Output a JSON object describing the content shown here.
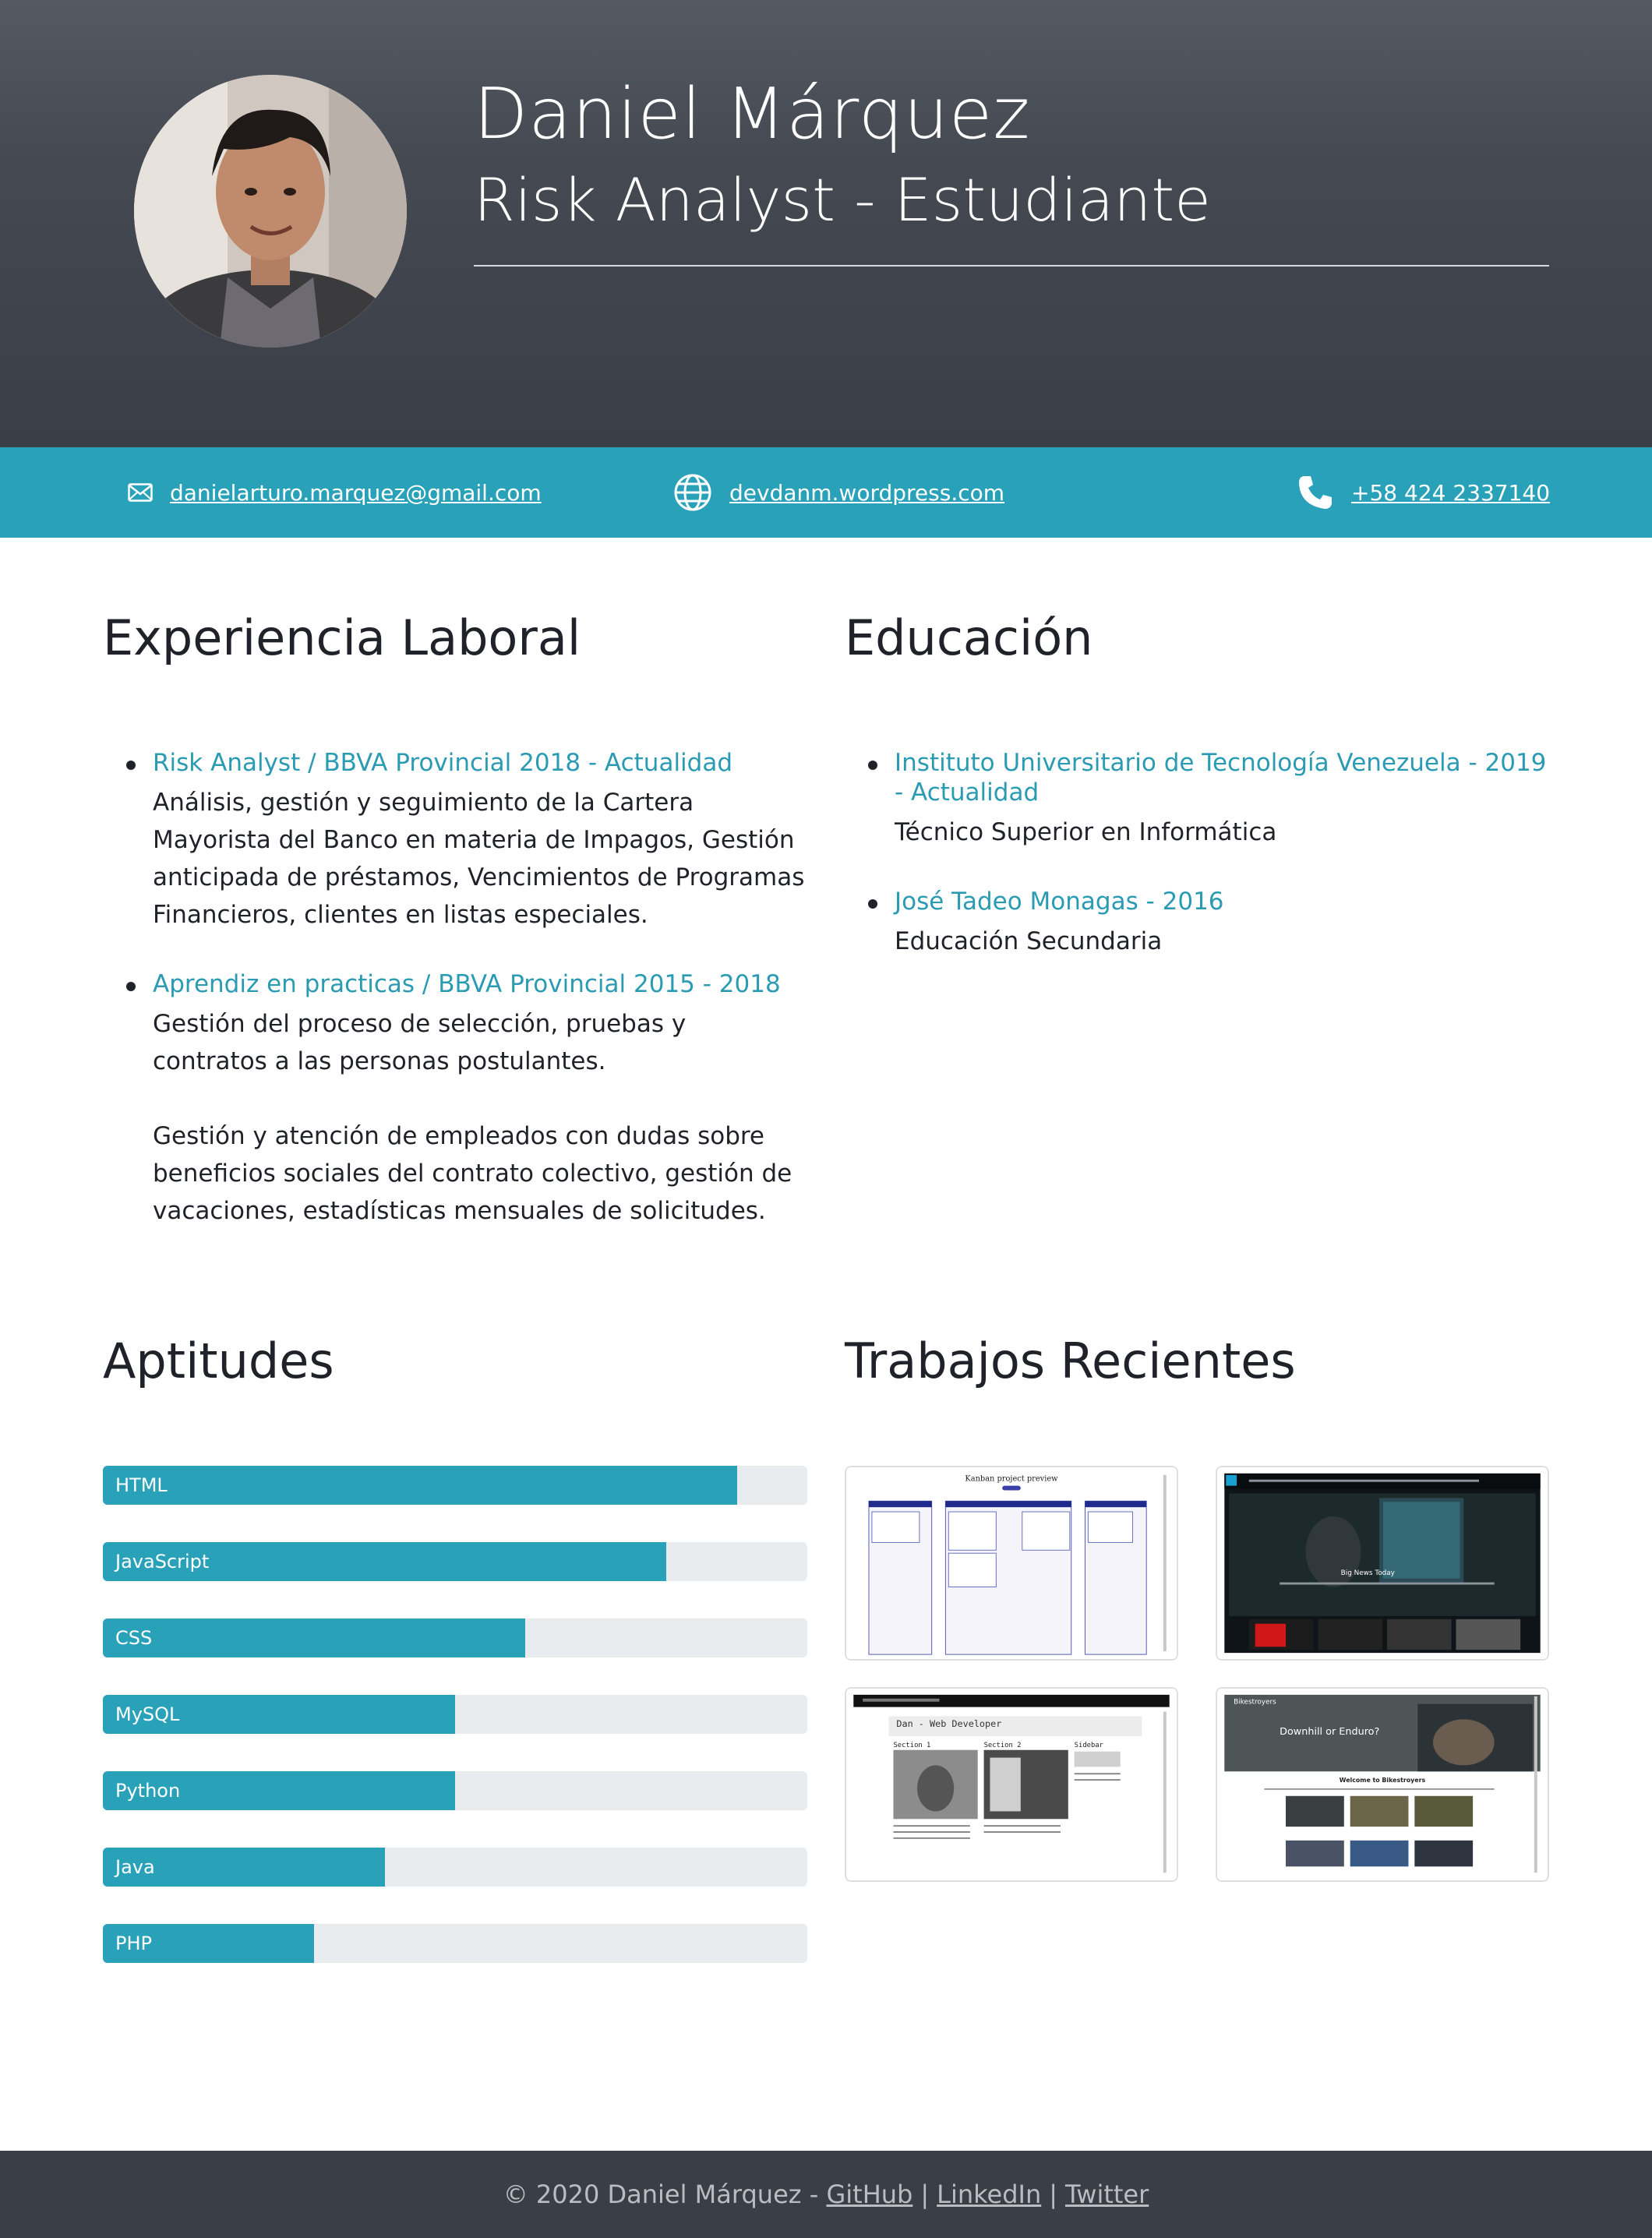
{
  "header": {
    "name": "Daniel Márquez",
    "role": "Risk Analyst - Estudiante"
  },
  "contact": {
    "email": "danielarturo.marquez@gmail.com",
    "website": "devdanm.wordpress.com",
    "phone": "+58 424 2337140"
  },
  "experience": {
    "title": "Experiencia Laboral",
    "items": [
      {
        "title": "Risk Analyst / BBVA Provincial 2018 - Actualidad",
        "desc": "Análisis, gestión y seguimiento de la Cartera Mayorista del Banco en materia de Impagos, Gestión anticipada de préstamos, Vencimientos de Programas Financieros, clientes en listas especiales."
      },
      {
        "title": "Aprendiz en practicas / BBVA Provincial 2015 - 2018",
        "desc": "Gestión del proceso de selección, pruebas y contratos a las personas postulantes.",
        "desc2": "Gestión y atención de empleados con dudas sobre beneficios sociales del contrato colectivo, gestión de vacaciones, estadísticas mensuales de solicitudes."
      }
    ]
  },
  "education": {
    "title": "Educación",
    "items": [
      {
        "title": "Instituto Universitario de Tecnología Venezuela - 2019 - Actualidad",
        "desc": "Técnico Superior en Informática"
      },
      {
        "title": "José Tadeo Monagas - 2016",
        "desc": "Educación Secundaria"
      }
    ]
  },
  "skills": {
    "title": "Aptitudes",
    "items": [
      {
        "label": "HTML",
        "level": 0.9
      },
      {
        "label": "JavaScript",
        "level": 0.8
      },
      {
        "label": "CSS",
        "level": 0.6
      },
      {
        "label": "MySQL",
        "level": 0.5
      },
      {
        "label": "Python",
        "level": 0.5
      },
      {
        "label": "Java",
        "level": 0.4
      },
      {
        "label": "PHP",
        "level": 0.3
      }
    ]
  },
  "works": {
    "title": "Trabajos Recientes",
    "kanban_title": "Kanban project preview",
    "blog_title": "Dan - Web Developer",
    "blog_sections": [
      "Section 1",
      "Section 2",
      "Sidebar"
    ],
    "news_title": "Big News Today",
    "bike_brand": "Bikestroyers",
    "bike_hero": "Downhill or Enduro?",
    "bike_welcome": "Welcome to Bikestroyers"
  },
  "footer": {
    "copyright": "© 2020 Daniel Márquez -",
    "github": "GitHub",
    "linkedin": "LinkedIn",
    "twitter": "Twitter",
    "separator": "|"
  },
  "colors": {
    "accent": "#29a2b9",
    "header_bg": "#454a52",
    "footer_bg": "#3a3e46",
    "track": "#e9ecef"
  }
}
